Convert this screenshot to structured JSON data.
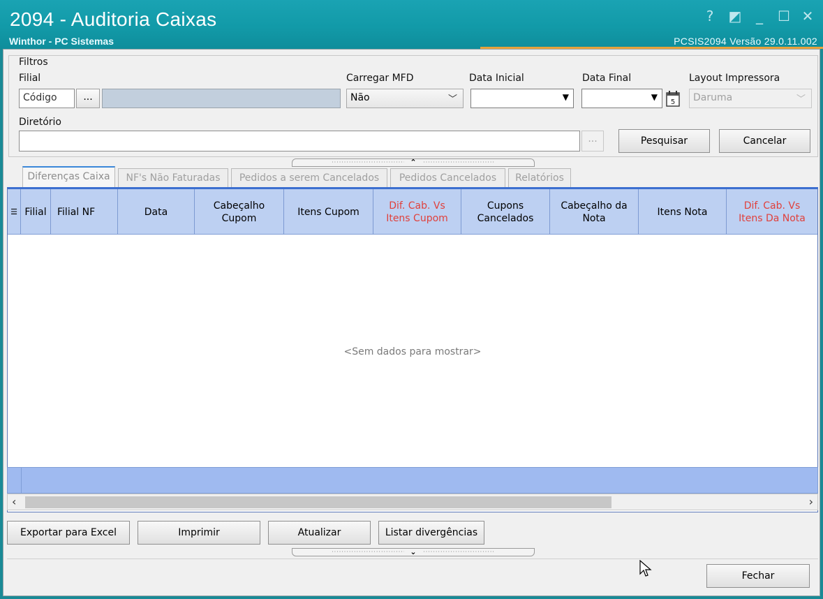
{
  "window": {
    "title": "2094 - Auditoria Caixas",
    "subtitle": "Winthor - PC Sistemas",
    "version": "PCSIS2094  Versão  29.0.11.002",
    "controls": {
      "help": "?",
      "restore_alt": "◩",
      "minimize": "_",
      "maximize": "☐",
      "close": "✕"
    }
  },
  "filtros": {
    "legend": "Filtros",
    "filial_label": "Filial",
    "filial_code_value": "Código",
    "lookup_button": "...",
    "filial_name_value": "",
    "carregar_mfd_label": "Carregar MFD",
    "carregar_mfd_value": "Não",
    "data_inicial_label": "Data Inicial",
    "data_final_label": "Data Final",
    "layout_label": "Layout Impressora",
    "layout_value": "Daruma",
    "diretorio_label": "Diretório",
    "diretorio_value": "",
    "diretorio_button": "...",
    "pesquisar_label": "Pesquisar",
    "cancelar_label": "Cancelar"
  },
  "tabs": [
    {
      "label": "Diferenças Caixa"
    },
    {
      "label": "NF's Não Faturadas"
    },
    {
      "label": "Pedidos a serem Cancelados"
    },
    {
      "label": "Pedidos Cancelados"
    },
    {
      "label": "Relatórios"
    }
  ],
  "grid": {
    "columns": [
      {
        "line1": "Filial",
        "line2": ""
      },
      {
        "line1": "Filial NF",
        "line2": ""
      },
      {
        "line1": "Data",
        "line2": ""
      },
      {
        "line1": "Cabeçalho",
        "line2": "Cupom"
      },
      {
        "line1": "Itens Cupom",
        "line2": ""
      },
      {
        "line1": "Dif. Cab. Vs",
        "line2": "Itens Cupom"
      },
      {
        "line1": "Cupons",
        "line2": "Cancelados"
      },
      {
        "line1": "Cabeçalho da",
        "line2": "Nota"
      },
      {
        "line1": "Itens Nota",
        "line2": ""
      },
      {
        "line1": "Dif. Cab. Vs",
        "line2": "Itens Da Nota"
      }
    ],
    "empty_message": "<Sem dados para mostrar>",
    "highlight_color": "#e0413c"
  },
  "actions": {
    "exportar": "Exportar para Excel",
    "imprimir": "Imprimir",
    "atualizar": "Atualizar",
    "listar": "Listar divergências",
    "fechar": "Fechar"
  }
}
